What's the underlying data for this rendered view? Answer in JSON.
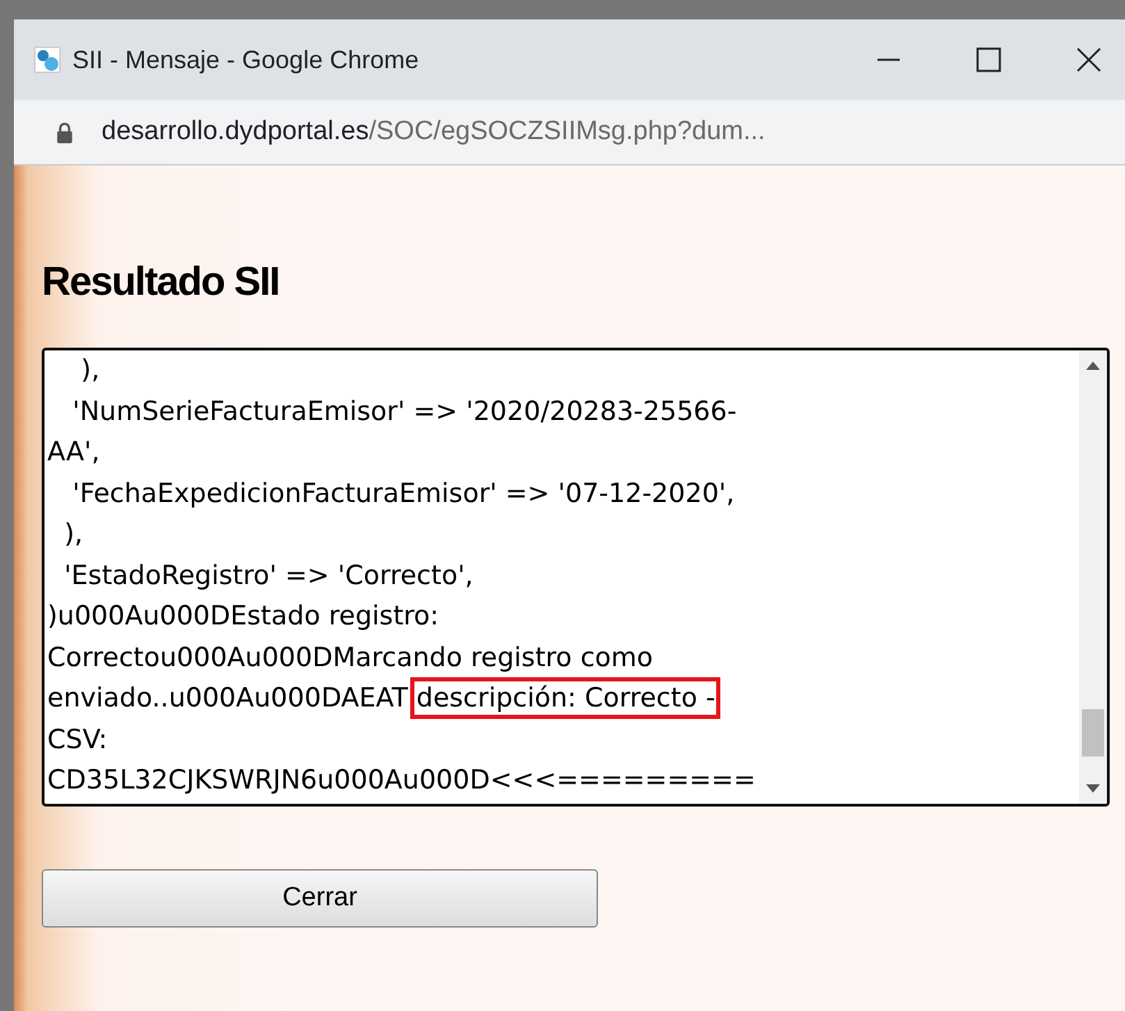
{
  "window": {
    "title": "SII - Mensaje - Google Chrome",
    "url_host": "desarrollo.dydportal.es",
    "url_path": "/SOC/egSOCZSIIMsg.php?dum..."
  },
  "heading": "Resultado SII",
  "result_text": {
    "lines": [
      {
        "kind": "plain",
        "text": "    ),"
      },
      {
        "kind": "plain",
        "text": "   'NumSerieFacturaEmisor' => '2020/20283-25566-"
      },
      {
        "kind": "plain",
        "text": "AA',"
      },
      {
        "kind": "plain",
        "text": "   'FechaExpedicionFacturaEmisor' => '07-12-2020',"
      },
      {
        "kind": "plain",
        "text": "  ),"
      },
      {
        "kind": "plain",
        "text": "  'EstadoRegistro' => 'Correcto',"
      },
      {
        "kind": "plain",
        "text": ")u000Au000DEstado registro:"
      },
      {
        "kind": "plain",
        "text": "Correctou000Au000DMarcando registro como"
      },
      {
        "kind": "highlighted",
        "text": "enviado..u000Au000DAEAT ",
        "highlight": "descripción: Correcto -"
      },
      {
        "kind": "plain",
        "text": "CSV:"
      },
      {
        "kind": "plain",
        "text": "CD35L32CJKSWRJN6u000Au000D<<<========="
      }
    ]
  },
  "buttons": [
    {
      "label": "Cerrar"
    }
  ]
}
